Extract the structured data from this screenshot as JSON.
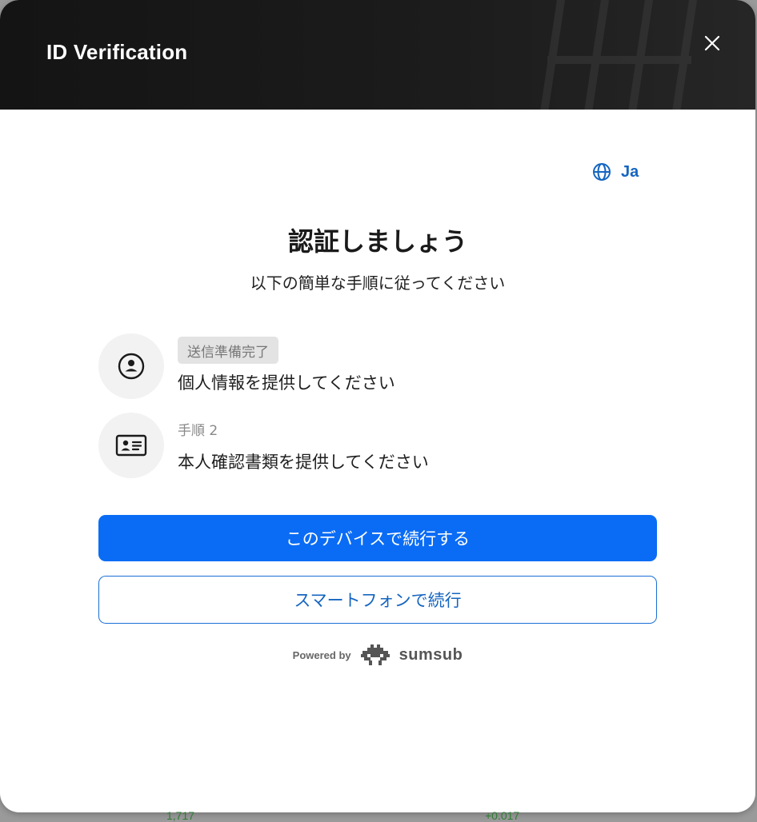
{
  "header": {
    "title": "ID Verification",
    "close_icon": "close-icon"
  },
  "language": {
    "icon": "globe-icon",
    "label": "Ja"
  },
  "main": {
    "title": "認証しましょう",
    "subtitle": "以下の簡単な手順に従ってください"
  },
  "steps": [
    {
      "icon": "person-circle-icon",
      "badge": "送信準備完了",
      "text": "個人情報を提供してください"
    },
    {
      "icon": "id-card-icon",
      "step_label": "手順 2",
      "text": "本人確認書類を提供してください"
    }
  ],
  "actions": {
    "primary": "このデバイスで続行する",
    "secondary": "スマートフォンで続行"
  },
  "footer": {
    "powered_by": "Powered by",
    "brand": "sumsub",
    "logo_icon": "sumsub-logo-icon"
  },
  "background": {
    "value_left": "1,717",
    "value_right": "+0.017"
  },
  "colors": {
    "primary": "#0a6cf5",
    "link": "#1565c0",
    "header_bg": "#1a1a1a"
  }
}
